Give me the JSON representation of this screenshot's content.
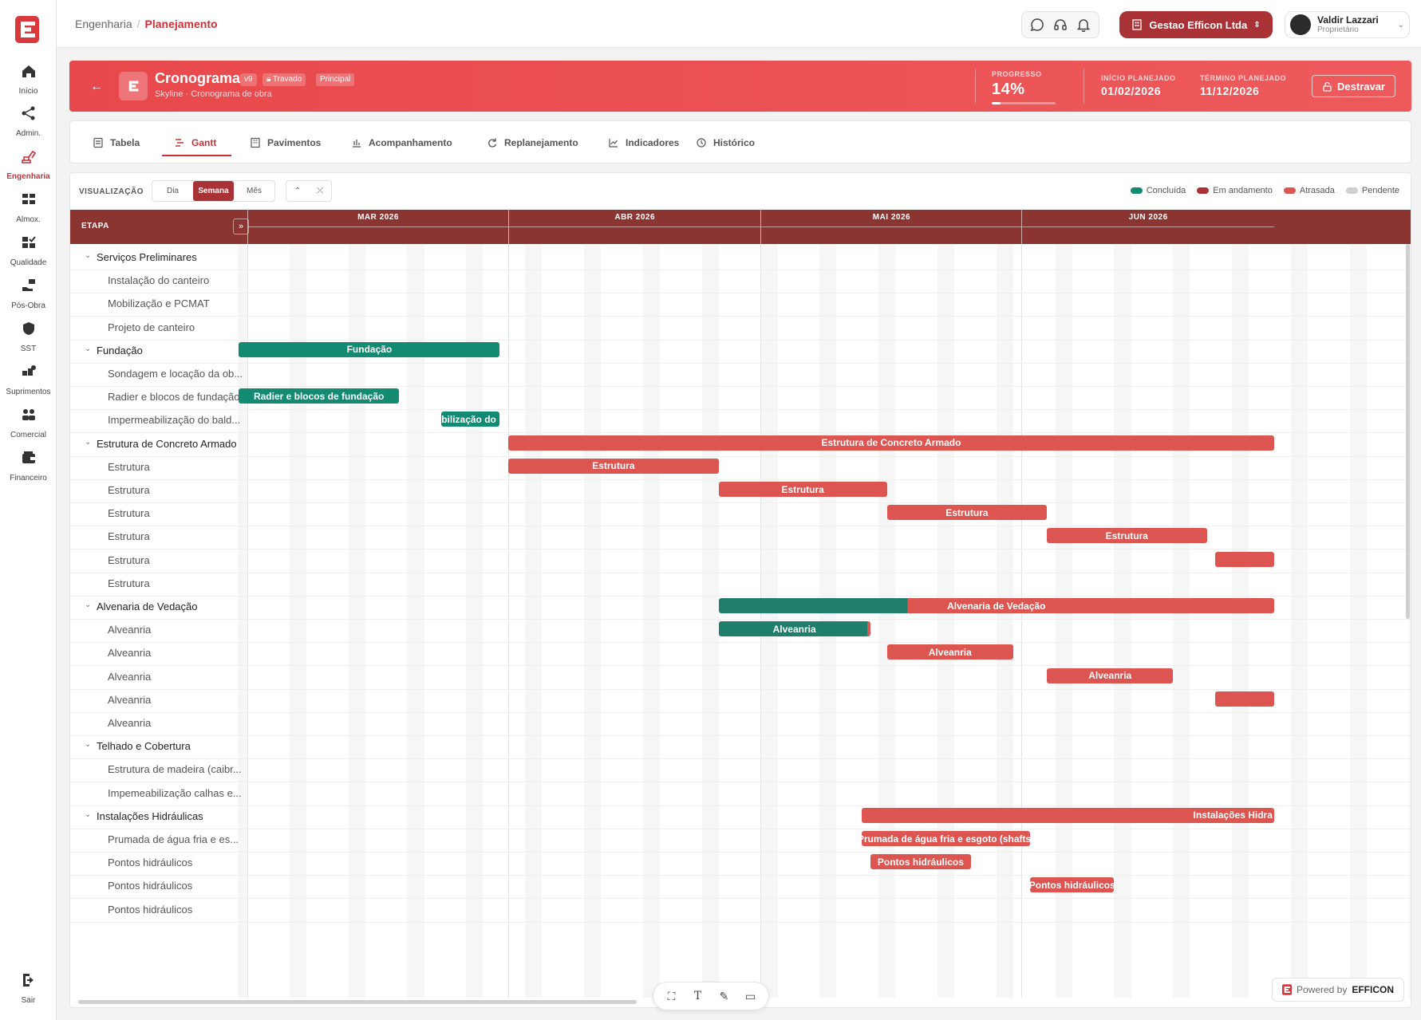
{
  "sidebar": {
    "items": [
      {
        "label": "Início",
        "icon": "home-icon"
      },
      {
        "label": "Admin.",
        "icon": "network-icon"
      },
      {
        "label": "Engenharia",
        "icon": "excavator-icon",
        "active": true
      },
      {
        "label": "Almox.",
        "icon": "warehouse-icon"
      },
      {
        "label": "Qualidade",
        "icon": "quality-check-icon"
      },
      {
        "label": "Pós-Obra",
        "icon": "handshake-icon"
      },
      {
        "label": "SST",
        "icon": "shield-icon"
      },
      {
        "label": "Suprimentos",
        "icon": "supplies-icon"
      },
      {
        "label": "Comercial",
        "icon": "people-icon"
      },
      {
        "label": "Financeiro",
        "icon": "wallet-icon"
      }
    ],
    "logout": "Sair"
  },
  "topbar": {
    "breadcrumb_root": "Engenharia",
    "breadcrumb_current": "Planejamento",
    "company": "Gestao Efficon Ltda",
    "user_name": "Valdir Lazzari",
    "user_role": "Proprietário"
  },
  "header": {
    "title": "Cronograma",
    "version": "v9",
    "lock_badge": "Travado",
    "main_badge": "Principal",
    "subtitle": "Skyline · Cronograma de obra",
    "progress_label": "PROGRESSO",
    "progress_value": "14%",
    "progress_fraction": 0.14,
    "start_label": "INÍCIO PLANEJADO",
    "start_value": "01/02/2026",
    "end_label": "TÉRMINO PLANEJADO",
    "end_value": "11/12/2026",
    "unlock_label": "Destravar"
  },
  "tabs": [
    {
      "label": "Tabela",
      "icon": "table-icon"
    },
    {
      "label": "Gantt",
      "icon": "gantt-icon",
      "active": true
    },
    {
      "label": "Pavimentos",
      "icon": "building-icon"
    },
    {
      "label": "Acompanhamento",
      "icon": "bar-chart-icon"
    },
    {
      "label": "Replanejamento",
      "icon": "refresh-icon"
    },
    {
      "label": "Indicadores",
      "icon": "line-chart-icon"
    },
    {
      "label": "Histórico",
      "icon": "history-icon"
    }
  ],
  "view": {
    "label": "VISUALIZAÇÃO",
    "options": [
      "Dia",
      "Semana",
      "Mês"
    ],
    "selected": "Semana"
  },
  "legend": [
    {
      "label": "Concluída",
      "color": "#138a72"
    },
    {
      "label": "Em andamento",
      "color": "#a93236"
    },
    {
      "label": "Atrasada",
      "color": "#dc5550"
    },
    {
      "label": "Pendente",
      "color": "#cfcfcf"
    }
  ],
  "gantt": {
    "column_label": "ETAPA",
    "months": [
      "MAR 2026",
      "ABR 2026",
      "MAI 2026",
      "JUN 2026"
    ],
    "rows": [
      {
        "name": "Serviços Preliminares",
        "group": true,
        "bars": []
      },
      {
        "name": "Instalação do canteiro",
        "bars": []
      },
      {
        "name": "Mobilização e PCMAT",
        "bars": []
      },
      {
        "name": "Projeto de canteiro",
        "bars": []
      },
      {
        "name": "Fundação",
        "group": true,
        "bars": [
          {
            "label": "Fundação",
            "status": "done",
            "start": "2026-02-28",
            "end": "2026-03-31"
          }
        ]
      },
      {
        "name": "Sondagem e locação da ob...",
        "bars": []
      },
      {
        "name": "Radier e blocos de fundação",
        "bars": [
          {
            "label": "Radier e blocos de fundação",
            "status": "done",
            "start": "2026-02-28",
            "end": "2026-03-19"
          }
        ]
      },
      {
        "name": "Impermeabilização do bald...",
        "bars": [
          {
            "label": "abilização do b",
            "status": "done",
            "start": "2026-03-24",
            "end": "2026-03-31"
          }
        ]
      },
      {
        "name": "Estrutura de Concreto Armado",
        "group": true,
        "bars": [
          {
            "label": "Estrutura de Concreto Armado",
            "status": "late",
            "start": "2026-04-01",
            "end": "2026-07-01"
          }
        ]
      },
      {
        "name": "Estrutura",
        "bars": [
          {
            "label": "Estrutura",
            "status": "late",
            "start": "2026-04-01",
            "end": "2026-04-26"
          }
        ]
      },
      {
        "name": "Estrutura",
        "bars": [
          {
            "label": "Estrutura",
            "status": "late",
            "start": "2026-04-26",
            "end": "2026-05-16"
          }
        ]
      },
      {
        "name": "Estrutura",
        "bars": [
          {
            "label": "Estrutura",
            "status": "late",
            "start": "2026-05-16",
            "end": "2026-06-04"
          }
        ]
      },
      {
        "name": "Estrutura",
        "bars": [
          {
            "label": "Estrutura",
            "status": "late",
            "start": "2026-06-04",
            "end": "2026-06-23"
          }
        ]
      },
      {
        "name": "Estrutura",
        "bars": [
          {
            "label": "",
            "status": "late",
            "start": "2026-06-24",
            "end": "2026-07-01"
          }
        ]
      },
      {
        "name": "Estrutura",
        "bars": []
      },
      {
        "name": "Alvenaria de Vedação",
        "group": true,
        "bars": [
          {
            "label": "Alvenaria de Vedação",
            "status": "progress",
            "start": "2026-04-26",
            "end": "2026-07-01",
            "done_fraction": 0.34
          }
        ]
      },
      {
        "name": "Alveanria",
        "bars": [
          {
            "label": "Alveanria",
            "status": "progress",
            "start": "2026-04-26",
            "end": "2026-05-14",
            "done_fraction": 0.98
          }
        ]
      },
      {
        "name": "Alveanria",
        "bars": [
          {
            "label": "Alveanria",
            "status": "late",
            "start": "2026-05-16",
            "end": "2026-05-31"
          }
        ]
      },
      {
        "name": "Alveanria",
        "bars": [
          {
            "label": "Alveanria",
            "status": "late",
            "start": "2026-06-04",
            "end": "2026-06-19"
          }
        ]
      },
      {
        "name": "Alveanria",
        "bars": [
          {
            "label": "",
            "status": "late",
            "start": "2026-06-24",
            "end": "2026-07-01"
          }
        ]
      },
      {
        "name": "Alveanria",
        "bars": []
      },
      {
        "name": "Telhado e Cobertura",
        "group": true,
        "bars": []
      },
      {
        "name": "Estrutura de madeira (caibr...",
        "bars": []
      },
      {
        "name": "Impemeabilização calhas e...",
        "bars": []
      },
      {
        "name": "Instalações Hidráulicas",
        "group": true,
        "bars": [
          {
            "label": "Instalações Hidra",
            "status": "late",
            "start": "2026-05-13",
            "end": "2026-07-01",
            "align": "right"
          }
        ]
      },
      {
        "name": "Prumada de água fria e es...",
        "bars": [
          {
            "label": "Prumada de água fria e esgoto (shafts)",
            "status": "late",
            "start": "2026-05-13",
            "end": "2026-06-02"
          }
        ]
      },
      {
        "name": "Pontos hidráulicos",
        "bars": [
          {
            "label": "Pontos hidráulicos",
            "status": "late",
            "start": "2026-05-14",
            "end": "2026-05-26"
          }
        ]
      },
      {
        "name": "Pontos hidráulicos",
        "bars": [
          {
            "label": "Pontos hidráulicos",
            "status": "late",
            "start": "2026-06-02",
            "end": "2026-06-12"
          }
        ]
      },
      {
        "name": "Pontos hidráulicos",
        "bars": []
      }
    ]
  },
  "footer": {
    "powered_by": "Powered by",
    "brand": "EFFICON"
  }
}
